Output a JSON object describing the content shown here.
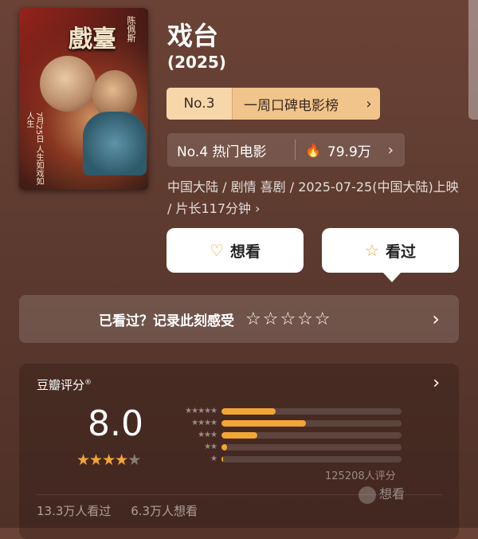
{
  "movie": {
    "title": "戏台",
    "year": "(2025)",
    "poster": {
      "title_text": "戲臺",
      "name_text": "陈佩斯",
      "date_text": "7月25日 人生如戏如人生"
    },
    "rank_primary": {
      "no": "No.3",
      "label": "一周口碑电影榜"
    },
    "rank_secondary": {
      "label": "No.4 热门电影",
      "heat": "79.9万"
    },
    "info_line": "中国大陆 / 剧情 喜剧 / 2025-07-25(中国大陆)上映 / 片长117分钟 ›",
    "buttons": {
      "want": "想看",
      "seen": "看过"
    },
    "record_prompt": "已看过？记录此刻感受",
    "record_stars": "☆☆☆☆☆"
  },
  "rating": {
    "header": "豆瓣评分",
    "registered": "®",
    "score": "8.0",
    "stars_filled": 4,
    "count_text": "125208人评分",
    "distribution": [
      {
        "stars": "★★★★★",
        "percent": 30
      },
      {
        "stars": "★★★★",
        "percent": 47
      },
      {
        "stars": "★★★",
        "percent": 20
      },
      {
        "stars": "★★",
        "percent": 3
      },
      {
        "stars": "★",
        "percent": 1
      }
    ],
    "seen_text": "13.3万人看过",
    "want_text": "6.3万人想看",
    "watermark": "想看"
  },
  "icons": {
    "heart_plus": "♡",
    "star_outline": "☆",
    "fire": "🔥",
    "chevron_right": "›"
  },
  "colors": {
    "accent": "#f3a535",
    "rank_bg": "#f0c48a"
  }
}
